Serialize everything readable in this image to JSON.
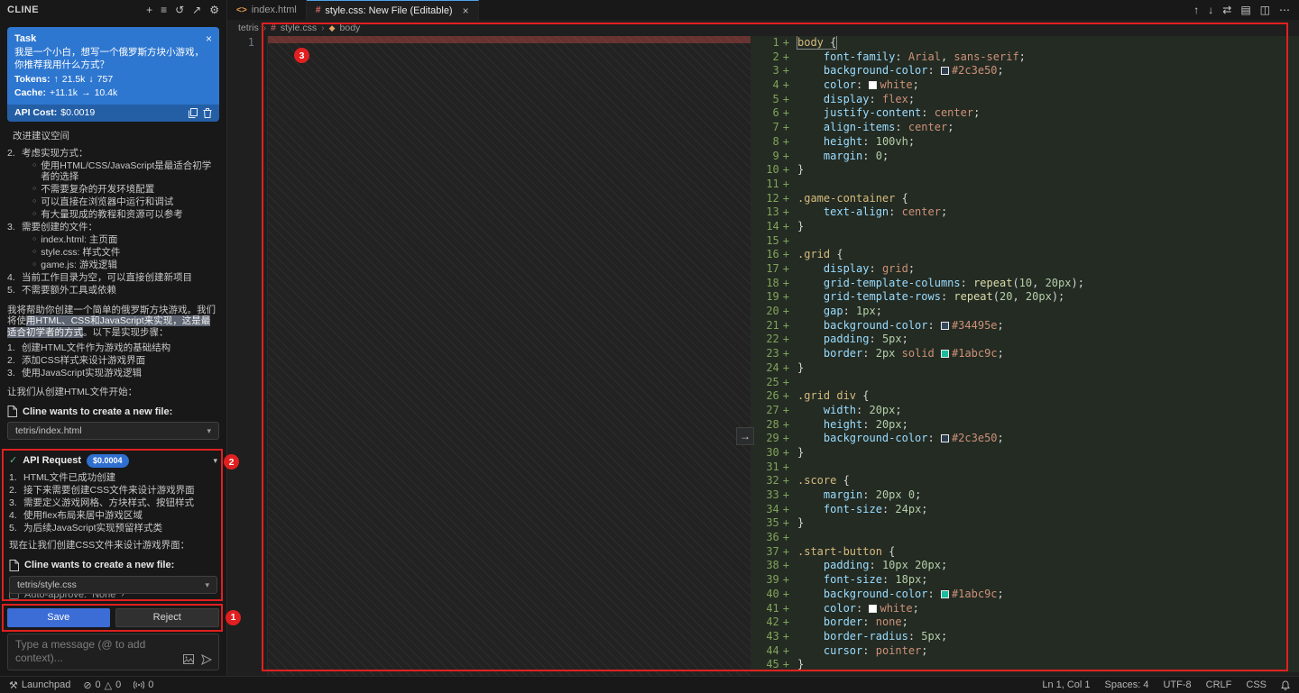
{
  "glyphs": {
    "plus": "+",
    "servers": "≡",
    "history": "↺",
    "open_editor": "↗",
    "gear": "⚙",
    "up": "↑",
    "down": "↓",
    "swap": "⇄",
    "book": "▤",
    "split": "◫",
    "more": "⋯",
    "close": "×",
    "chev_down": "▾",
    "chev_right": "›",
    "check": "✓",
    "arrow_r": "→",
    "bullet": "○",
    "error": "⊘",
    "warning": "△",
    "tools": "⚒"
  },
  "colors": {
    "annotation_red": "#e02020",
    "task_card_blue": "#2e77d0",
    "save_button_blue": "#3c6cd6",
    "cost_badge_blue": "#2f6fd0",
    "accent_teal": "#1abc9c"
  },
  "titlebar": {
    "app": "CLINE"
  },
  "tabs": {
    "tab1": {
      "label": "index.html",
      "icon": "<>"
    },
    "tab2": {
      "label": "style.css: New File (Editable)",
      "icon": "#"
    }
  },
  "breadcrumb": {
    "folder": "tetris",
    "file": "style.css",
    "symbol": "body"
  },
  "sidebar": {
    "task": {
      "title": "Task",
      "text": "我是一个小白，想写一个俄罗斯方块小游戏，你推荐我用什么方式？",
      "tokens_label": "Tokens:",
      "tokens_up": "21.5k",
      "tokens_down": "757",
      "cache_label": "Cache:",
      "cache_in": "+11.1k",
      "cache_out": "10.4k",
      "cost_label": "API Cost:",
      "cost": "$0.0019"
    }
  },
  "chat": {
    "fragment": "改进建议空间",
    "outline": [
      {
        "n": "2.",
        "text": "考虑实现方式：",
        "subs": [
          "使用HTML/CSS/JavaScript是最适合初学者的选择",
          "不需要复杂的开发环境配置",
          "可以直接在浏览器中运行和调试",
          "有大量现成的教程和资源可以参考"
        ]
      },
      {
        "n": "3.",
        "text": "需要创建的文件：",
        "subs": [
          "index.html: 主页面",
          "style.css: 样式文件",
          "game.js: 游戏逻辑"
        ]
      },
      {
        "n": "4.",
        "text": "当前工作目录为空，可以直接创建新项目",
        "subs": []
      },
      {
        "n": "5.",
        "text": "不需要额外工具或依赖",
        "subs": []
      }
    ],
    "paragraph": {
      "pre": "我将帮助你创建一个简单的俄罗斯方块游戏。我们将使",
      "hl": "用HTML、CSS和JavaScript来实现，这是最适合初学者的方式",
      "post": "。以下是实现步骤："
    },
    "steps": [
      "创建HTML文件作为游戏的基础结构",
      "添加CSS样式来设计游戏界面",
      "使用JavaScript实现游戏逻辑"
    ],
    "lead1": "让我们从创建HTML文件开始：",
    "prompt1": {
      "label": "Cline wants to create a new file:",
      "file": "tetris/index.html"
    },
    "api_request": {
      "label": "API Request",
      "cost": "$0.0004",
      "items": [
        "HTML文件已成功创建",
        "接下来需要创建CSS文件来设计游戏界面",
        "需要定义游戏网格、方块样式、按钮样式",
        "使用flex布局来居中游戏区域",
        "为后续JavaScript实现预留样式类"
      ],
      "lead": "现在让我们创建CSS文件来设计游戏界面："
    },
    "prompt2": {
      "label": "Cline wants to create a new file:",
      "file": "tetris/style.css"
    },
    "auto_approve": {
      "label": "Auto-approve:",
      "value": "None"
    },
    "buttons": {
      "save": "Save",
      "reject": "Reject"
    },
    "input_placeholder": "Type a message (@ to add context)..."
  },
  "editor": {
    "left_line_number": "1",
    "lines": [
      [
        [
          "s",
          "body"
        ],
        [
          "u",
          " {"
        ]
      ],
      [
        [
          "u",
          "    "
        ],
        [
          "p",
          "font-family"
        ],
        [
          "u",
          ": "
        ],
        [
          "t",
          "Arial"
        ],
        [
          "u",
          ", "
        ],
        [
          "t",
          "sans-serif"
        ],
        [
          "u",
          ";"
        ]
      ],
      [
        [
          "u",
          "    "
        ],
        [
          "p",
          "background-color"
        ],
        [
          "u",
          ": "
        ],
        [
          "w",
          "#2c3e50"
        ],
        [
          "t",
          "#2c3e50"
        ],
        [
          "u",
          ";"
        ]
      ],
      [
        [
          "u",
          "    "
        ],
        [
          "p",
          "color"
        ],
        [
          "u",
          ": "
        ],
        [
          "w",
          "#ffffff"
        ],
        [
          "t",
          "white"
        ],
        [
          "u",
          ";"
        ]
      ],
      [
        [
          "u",
          "    "
        ],
        [
          "p",
          "display"
        ],
        [
          "u",
          ": "
        ],
        [
          "t",
          "flex"
        ],
        [
          "u",
          ";"
        ]
      ],
      [
        [
          "u",
          "    "
        ],
        [
          "p",
          "justify-content"
        ],
        [
          "u",
          ": "
        ],
        [
          "t",
          "center"
        ],
        [
          "u",
          ";"
        ]
      ],
      [
        [
          "u",
          "    "
        ],
        [
          "p",
          "align-items"
        ],
        [
          "u",
          ": "
        ],
        [
          "t",
          "center"
        ],
        [
          "u",
          ";"
        ]
      ],
      [
        [
          "u",
          "    "
        ],
        [
          "p",
          "height"
        ],
        [
          "u",
          ": "
        ],
        [
          "n",
          "100vh"
        ],
        [
          "u",
          ";"
        ]
      ],
      [
        [
          "u",
          "    "
        ],
        [
          "p",
          "margin"
        ],
        [
          "u",
          ": "
        ],
        [
          "n",
          "0"
        ],
        [
          "u",
          ";"
        ]
      ],
      [
        [
          "u",
          "}"
        ]
      ],
      [],
      [
        [
          "s",
          ".game-container"
        ],
        [
          "u",
          " {"
        ]
      ],
      [
        [
          "u",
          "    "
        ],
        [
          "p",
          "text-align"
        ],
        [
          "u",
          ": "
        ],
        [
          "t",
          "center"
        ],
        [
          "u",
          ";"
        ]
      ],
      [
        [
          "u",
          "}"
        ]
      ],
      [],
      [
        [
          "s",
          ".grid"
        ],
        [
          "u",
          " {"
        ]
      ],
      [
        [
          "u",
          "    "
        ],
        [
          "p",
          "display"
        ],
        [
          "u",
          ": "
        ],
        [
          "t",
          "grid"
        ],
        [
          "u",
          ";"
        ]
      ],
      [
        [
          "u",
          "    "
        ],
        [
          "p",
          "grid-template-columns"
        ],
        [
          "u",
          ": "
        ],
        [
          "f",
          "repeat"
        ],
        [
          "u",
          "("
        ],
        [
          "n",
          "10"
        ],
        [
          "u",
          ", "
        ],
        [
          "n",
          "20px"
        ],
        [
          "u",
          ");"
        ]
      ],
      [
        [
          "u",
          "    "
        ],
        [
          "p",
          "grid-template-rows"
        ],
        [
          "u",
          ": "
        ],
        [
          "f",
          "repeat"
        ],
        [
          "u",
          "("
        ],
        [
          "n",
          "20"
        ],
        [
          "u",
          ", "
        ],
        [
          "n",
          "20px"
        ],
        [
          "u",
          ");"
        ]
      ],
      [
        [
          "u",
          "    "
        ],
        [
          "p",
          "gap"
        ],
        [
          "u",
          ": "
        ],
        [
          "n",
          "1px"
        ],
        [
          "u",
          ";"
        ]
      ],
      [
        [
          "u",
          "    "
        ],
        [
          "p",
          "background-color"
        ],
        [
          "u",
          ": "
        ],
        [
          "w",
          "#34495e"
        ],
        [
          "t",
          "#34495e"
        ],
        [
          "u",
          ";"
        ]
      ],
      [
        [
          "u",
          "    "
        ],
        [
          "p",
          "padding"
        ],
        [
          "u",
          ": "
        ],
        [
          "n",
          "5px"
        ],
        [
          "u",
          ";"
        ]
      ],
      [
        [
          "u",
          "    "
        ],
        [
          "p",
          "border"
        ],
        [
          "u",
          ": "
        ],
        [
          "n",
          "2px"
        ],
        [
          "u",
          " "
        ],
        [
          "t",
          "solid"
        ],
        [
          "u",
          " "
        ],
        [
          "w",
          "#1abc9c"
        ],
        [
          "t",
          "#1abc9c"
        ],
        [
          "u",
          ";"
        ]
      ],
      [
        [
          "u",
          "}"
        ]
      ],
      [],
      [
        [
          "s",
          ".grid div"
        ],
        [
          "u",
          " {"
        ]
      ],
      [
        [
          "u",
          "    "
        ],
        [
          "p",
          "width"
        ],
        [
          "u",
          ": "
        ],
        [
          "n",
          "20px"
        ],
        [
          "u",
          ";"
        ]
      ],
      [
        [
          "u",
          "    "
        ],
        [
          "p",
          "height"
        ],
        [
          "u",
          ": "
        ],
        [
          "n",
          "20px"
        ],
        [
          "u",
          ";"
        ]
      ],
      [
        [
          "u",
          "    "
        ],
        [
          "p",
          "background-color"
        ],
        [
          "u",
          ": "
        ],
        [
          "w",
          "#2c3e50"
        ],
        [
          "t",
          "#2c3e50"
        ],
        [
          "u",
          ";"
        ]
      ],
      [
        [
          "u",
          "}"
        ]
      ],
      [],
      [
        [
          "s",
          ".score"
        ],
        [
          "u",
          " {"
        ]
      ],
      [
        [
          "u",
          "    "
        ],
        [
          "p",
          "margin"
        ],
        [
          "u",
          ": "
        ],
        [
          "n",
          "20px"
        ],
        [
          "u",
          " "
        ],
        [
          "n",
          "0"
        ],
        [
          "u",
          ";"
        ]
      ],
      [
        [
          "u",
          "    "
        ],
        [
          "p",
          "font-size"
        ],
        [
          "u",
          ": "
        ],
        [
          "n",
          "24px"
        ],
        [
          "u",
          ";"
        ]
      ],
      [
        [
          "u",
          "}"
        ]
      ],
      [],
      [
        [
          "s",
          ".start-button"
        ],
        [
          "u",
          " {"
        ]
      ],
      [
        [
          "u",
          "    "
        ],
        [
          "p",
          "padding"
        ],
        [
          "u",
          ": "
        ],
        [
          "n",
          "10px"
        ],
        [
          "u",
          " "
        ],
        [
          "n",
          "20px"
        ],
        [
          "u",
          ";"
        ]
      ],
      [
        [
          "u",
          "    "
        ],
        [
          "p",
          "font-size"
        ],
        [
          "u",
          ": "
        ],
        [
          "n",
          "18px"
        ],
        [
          "u",
          ";"
        ]
      ],
      [
        [
          "u",
          "    "
        ],
        [
          "p",
          "background-color"
        ],
        [
          "u",
          ": "
        ],
        [
          "w",
          "#1abc9c"
        ],
        [
          "t",
          "#1abc9c"
        ],
        [
          "u",
          ";"
        ]
      ],
      [
        [
          "u",
          "    "
        ],
        [
          "p",
          "color"
        ],
        [
          "u",
          ": "
        ],
        [
          "w",
          "#ffffff"
        ],
        [
          "t",
          "white"
        ],
        [
          "u",
          ";"
        ]
      ],
      [
        [
          "u",
          "    "
        ],
        [
          "p",
          "border"
        ],
        [
          "u",
          ": "
        ],
        [
          "t",
          "none"
        ],
        [
          "u",
          ";"
        ]
      ],
      [
        [
          "u",
          "    "
        ],
        [
          "p",
          "border-radius"
        ],
        [
          "u",
          ": "
        ],
        [
          "n",
          "5px"
        ],
        [
          "u",
          ";"
        ]
      ],
      [
        [
          "u",
          "    "
        ],
        [
          "p",
          "cursor"
        ],
        [
          "u",
          ": "
        ],
        [
          "t",
          "pointer"
        ],
        [
          "u",
          ";"
        ]
      ],
      [
        [
          "u",
          "}"
        ]
      ]
    ]
  },
  "statusbar": {
    "launchpad": "Launchpad",
    "errors": "0",
    "warnings": "0",
    "ports": "0",
    "ln_col": "Ln 1, Col 1",
    "spaces": "Spaces: 4",
    "encoding": "UTF-8",
    "eol": "CRLF",
    "lang": "CSS"
  },
  "annotations": {
    "badge_buttons": "1",
    "badge_api": "2",
    "badge_editor": "3"
  }
}
